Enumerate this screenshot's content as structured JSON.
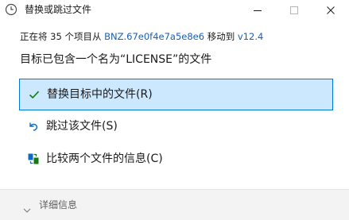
{
  "window": {
    "title": "替换或跳过文件"
  },
  "info": {
    "prefix": "正在将 35 个项目从 ",
    "source": "BNZ.67e0f4e7a5e8e6",
    "middle": " 移动到 ",
    "destination": "v12.4"
  },
  "heading": "目标已包含一个名为“LICENSE”的文件",
  "options": {
    "replace": "替换目标中的文件(R)",
    "skip": "跳过该文件(S)",
    "compare": "比较两个文件的信息(C)"
  },
  "footer": {
    "details": "详细信息"
  },
  "colors": {
    "accent": "#0078d7",
    "selected_bg": "#cce8ff",
    "link": "#1a5fb4",
    "check": "#107c10"
  }
}
